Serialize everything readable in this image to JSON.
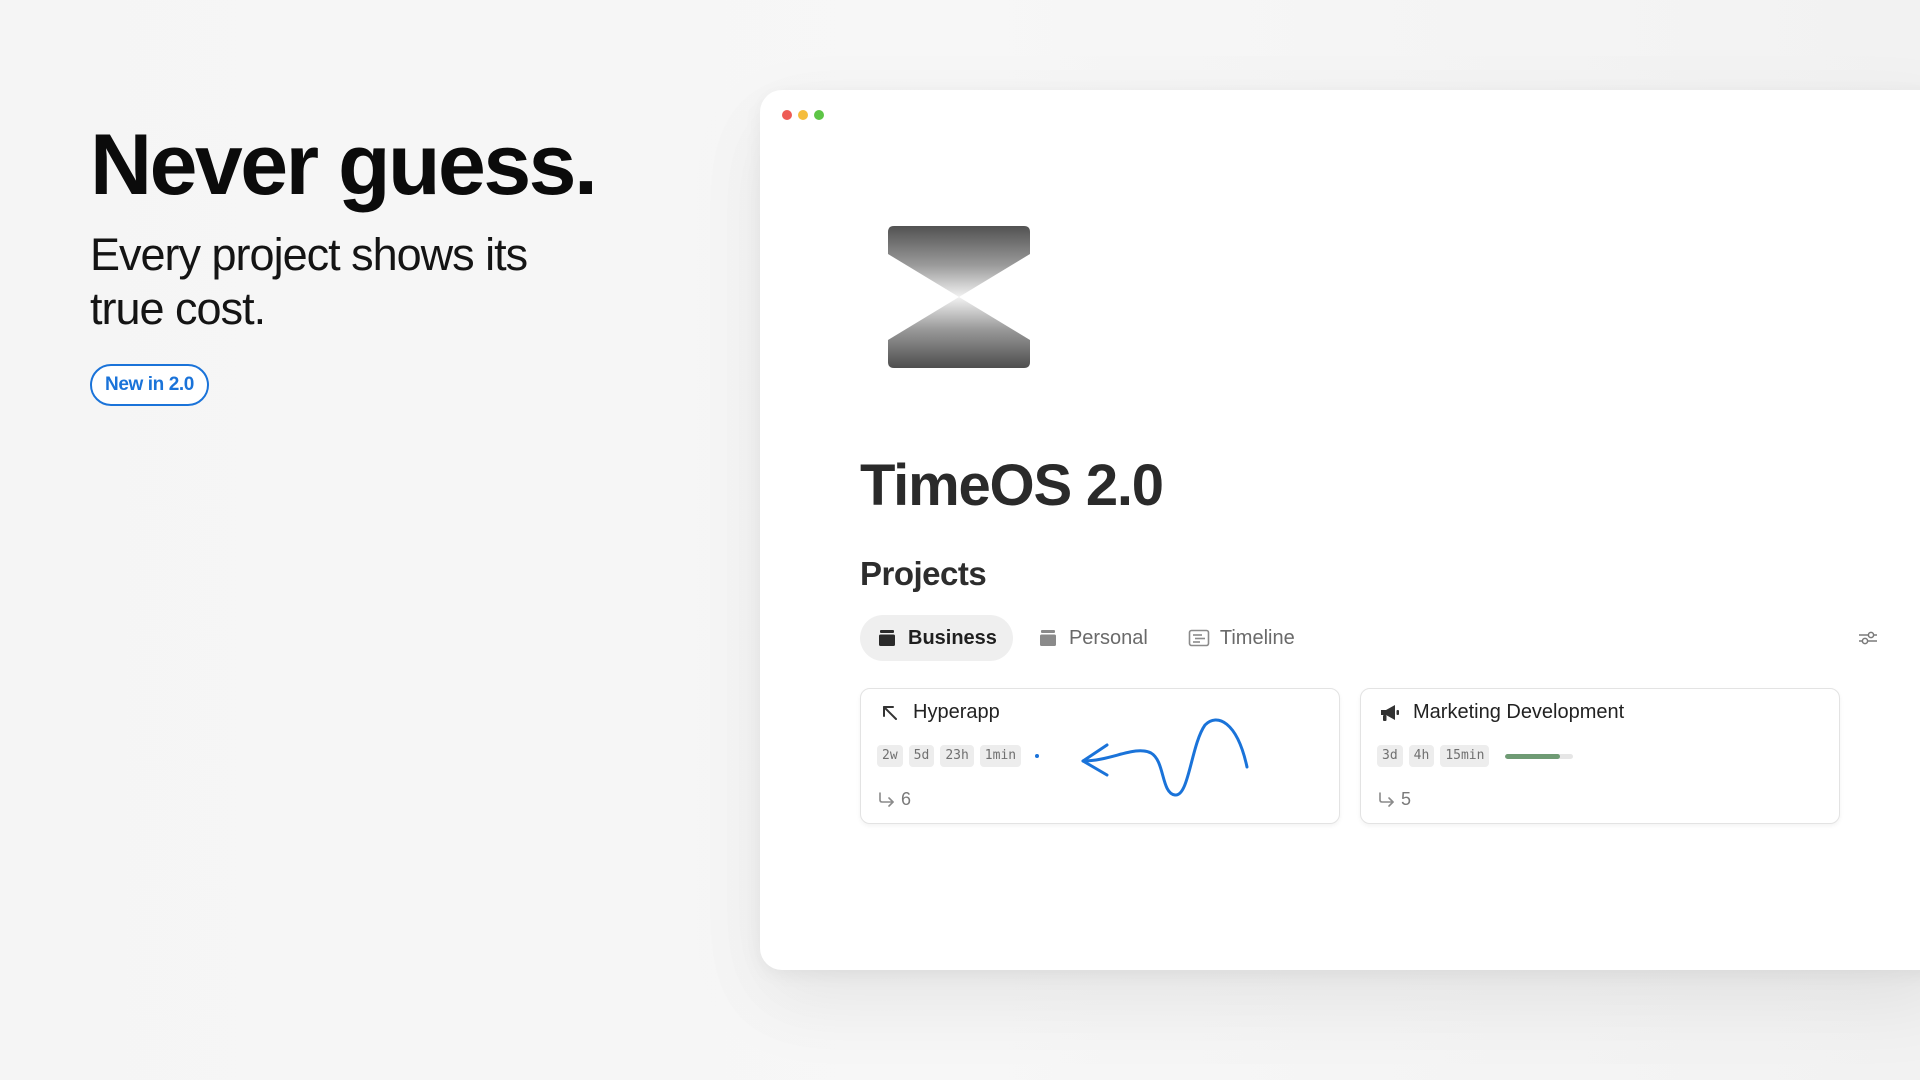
{
  "hero": {
    "title": "Never guess.",
    "subtitle": "Every project shows its true cost.",
    "badge": "New in 2.0",
    "badge_color": "#1a73d9"
  },
  "window": {
    "controls": [
      "close",
      "minimize",
      "zoom"
    ],
    "logo_icon": "hourglass-logo-icon"
  },
  "app": {
    "title": "TimeOS 2.0",
    "section_title": "Projects"
  },
  "tabs": [
    {
      "label": "Business",
      "icon": "tray-icon",
      "active": true
    },
    {
      "label": "Personal",
      "icon": "tray-icon",
      "active": false
    },
    {
      "label": "Timeline",
      "icon": "timeline-icon",
      "active": false
    }
  ],
  "toolbar": {
    "filter_icon": "sliders-icon"
  },
  "cards": [
    {
      "title": "Hyperapp",
      "icon": "arrow-up-left-icon",
      "chips": [
        "2w",
        "5d",
        "23h",
        "1min"
      ],
      "indicator": "blue-dot",
      "subcount": "6",
      "annotation": "hand-drawn-arrow"
    },
    {
      "title": "Marketing Development",
      "icon": "megaphone-icon",
      "chips": [
        "3d",
        "4h",
        "15min"
      ],
      "progress": 0.8,
      "progress_color": "#6f9b74",
      "subcount": "5"
    }
  ]
}
